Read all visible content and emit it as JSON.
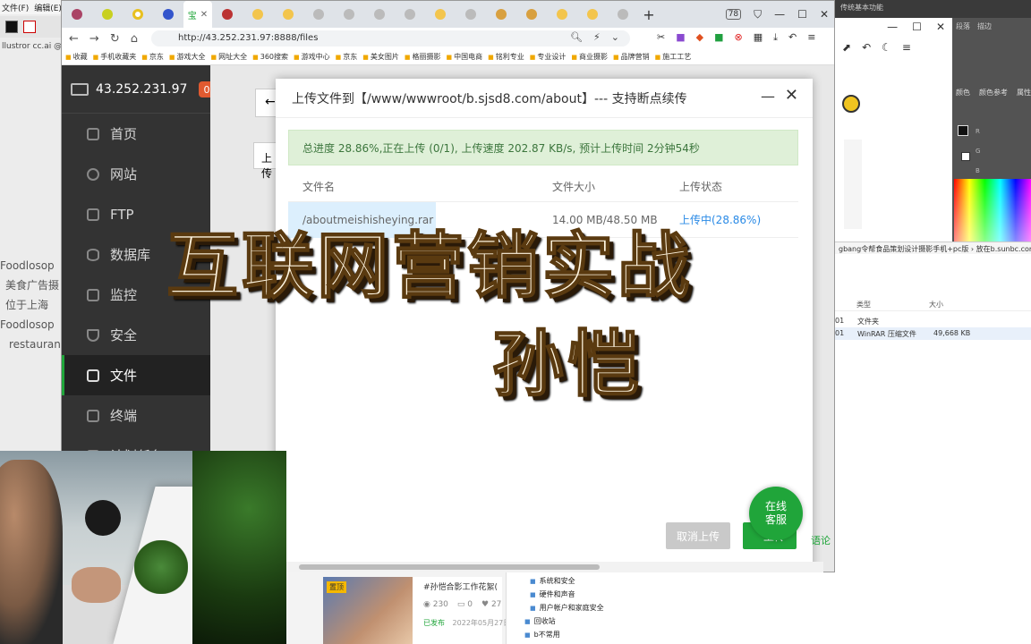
{
  "illustrator": {
    "menu": [
      "文件(F)",
      "编辑(E)"
    ],
    "file_tab": "llustror cc.ai @",
    "canvas_text": [
      "Foodlosop",
      "美食广告摄",
      "位于上海",
      "Foodlosop",
      "restauran"
    ]
  },
  "browser": {
    "url": "http://43.252.231.97:8888/files",
    "tab_count": "78",
    "bookmarks": [
      "收藏",
      "手机收藏夹",
      "京东",
      "游戏大全",
      "网址大全",
      "360搜索",
      "游戏中心",
      "京东",
      "美女图片",
      "格丽摄影",
      "中国电商",
      "铭利专业",
      "专业设计",
      "商业摄影",
      "品牌营销",
      "施工工艺"
    ]
  },
  "panel": {
    "ip": "43.252.231.97",
    "notice_count": "0",
    "nav": [
      "首页",
      "网站",
      "FTP",
      "数据库",
      "监控",
      "安全",
      "文件",
      "终端",
      "计划任务"
    ],
    "active_nav": "文件",
    "main_hint": "上传"
  },
  "dialog": {
    "title": "上传文件到【/www/wwwroot/b.sjsd8.com/about】--- 支持断点续传",
    "progress_text": "总进度 28.86%,正在上传 (0/1),  上传速度 202.87 KB/s,  预计上传时间 2分钟54秒",
    "progress": 0.2886,
    "columns": [
      "文件名",
      "文件大小",
      "上传状态"
    ],
    "rows": [
      {
        "name": "/aboutmeishisheying.rar",
        "size": "14.00 MB/48.50 MB",
        "status": "上传中(28.86%)"
      }
    ],
    "cancel_label": "取消上传",
    "upload_label": "上传"
  },
  "chat": {
    "line1": "在线",
    "line2": "客服"
  },
  "overlay": {
    "line1": "互联网营销实战",
    "line2": "孙恺"
  },
  "right": {
    "ps_top": "传统基本功能",
    "ps_tabs": [
      "颜色",
      "颜色参考",
      "属性"
    ],
    "ps_tabs_top": [
      "段落",
      "描边"
    ],
    "path": "gbang令帮食品策划设计摄影手机+pc版  ›  放在b.sunbc.com",
    "explorer_header": [
      "类型",
      "大小"
    ],
    "explorer_rows": [
      {
        "date": "01",
        "type": "文件夹",
        "size": ""
      },
      {
        "date": "01",
        "type": "WinRAR 压缩文件",
        "size": "49,668 KB"
      }
    ],
    "side_text": "语论"
  },
  "post": {
    "badge": "置顶",
    "title": "#孙恺合影工作花絮(",
    "views": "230",
    "comments": "0",
    "likes": "27",
    "status": "已发布",
    "date": "2022年05月27日"
  },
  "tree": [
    "系统和安全",
    "硬件和声音",
    "用户帐户和家庭安全",
    "回收站",
    "b不常用"
  ]
}
